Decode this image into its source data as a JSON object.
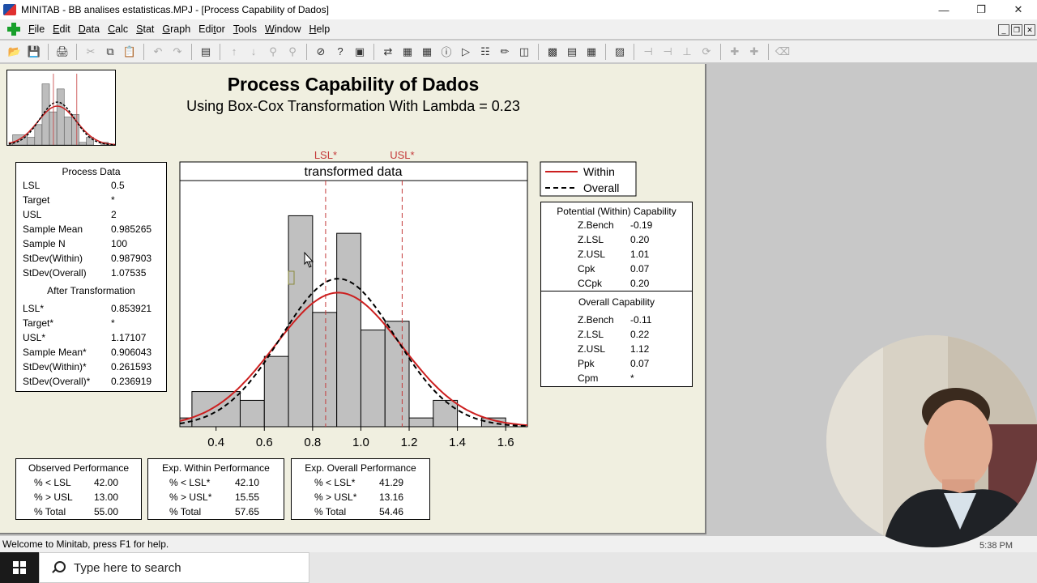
{
  "window": {
    "title": "MINITAB - BB analises estatisticas.MPJ - [Process Capability of Dados]"
  },
  "menu": [
    {
      "key": "F",
      "rest": "ile"
    },
    {
      "key": "E",
      "rest": "dit"
    },
    {
      "key": "D",
      "rest": "ata"
    },
    {
      "key": "C",
      "rest": "alc"
    },
    {
      "key": "S",
      "rest": "tat"
    },
    {
      "key": "G",
      "rest": "raph"
    },
    {
      "key": "",
      "rest": "Edi",
      "key2": "t",
      "rest2": "or"
    },
    {
      "key": "T",
      "rest": "ools"
    },
    {
      "key": "W",
      "rest": "indow"
    },
    {
      "key": "H",
      "rest": "elp"
    }
  ],
  "graph": {
    "title": "Process Capability of Dados",
    "subtitle": "Using Box-Cox Transformation With Lambda = 0.23",
    "panel_label": "transformed data",
    "lsl_label": "LSL*",
    "usl_label": "USL*",
    "legend": {
      "within": "Within",
      "overall": "Overall"
    },
    "colors": {
      "within": "#cc1f1f",
      "overall": "#000000",
      "bars": "#c0c0c0",
      "spec": "#c43a3a",
      "background": "#f0efe0"
    }
  },
  "process_data": {
    "header": "Process Data",
    "rows": [
      {
        "label": "LSL",
        "value": "0.5"
      },
      {
        "label": "Target",
        "value": "*"
      },
      {
        "label": "USL",
        "value": "2"
      },
      {
        "label": "Sample Mean",
        "value": "0.985265"
      },
      {
        "label": "Sample N",
        "value": "100"
      },
      {
        "label": "StDev(Within)",
        "value": "0.987903"
      },
      {
        "label": "StDev(Overall)",
        "value": "1.07535"
      }
    ],
    "after_header": "After Transformation",
    "after_rows": [
      {
        "label": "LSL*",
        "value": "0.853921"
      },
      {
        "label": "Target*",
        "value": "*"
      },
      {
        "label": "USL*",
        "value": "1.17107"
      },
      {
        "label": "Sample Mean*",
        "value": "0.906043"
      },
      {
        "label": "StDev(Within)*",
        "value": "0.261593"
      },
      {
        "label": "StDev(Overall)*",
        "value": "0.236919"
      }
    ]
  },
  "potential": {
    "header": "Potential (Within) Capability",
    "rows": [
      {
        "label": "Z.Bench",
        "value": "-0.19"
      },
      {
        "label": "Z.LSL",
        "value": "0.20"
      },
      {
        "label": "Z.USL",
        "value": "1.01"
      },
      {
        "label": "Cpk",
        "value": "0.07"
      },
      {
        "label": "CCpk",
        "value": "0.20"
      }
    ]
  },
  "overall": {
    "header": "Overall Capability",
    "rows": [
      {
        "label": "Z.Bench",
        "value": "-0.11"
      },
      {
        "label": "Z.LSL",
        "value": "0.22"
      },
      {
        "label": "Z.USL",
        "value": "1.12"
      },
      {
        "label": "Ppk",
        "value": "0.07"
      },
      {
        "label": "Cpm",
        "value": "*"
      }
    ]
  },
  "observed": {
    "header": "Observed Performance",
    "rows": [
      {
        "label": "% < LSL",
        "value": "42.00"
      },
      {
        "label": "% > USL",
        "value": "13.00"
      },
      {
        "label": "% Total",
        "value": "55.00"
      }
    ]
  },
  "exp_within": {
    "header": "Exp. Within Performance",
    "rows": [
      {
        "label": "% < LSL*",
        "value": "42.10"
      },
      {
        "label": "% > USL*",
        "value": "15.55"
      },
      {
        "label": "% Total",
        "value": "57.65"
      }
    ]
  },
  "exp_overall": {
    "header": "Exp. Overall Performance",
    "rows": [
      {
        "label": "% < LSL*",
        "value": "41.29"
      },
      {
        "label": "% > USL*",
        "value": "13.16"
      },
      {
        "label": "% Total",
        "value": "54.46"
      }
    ]
  },
  "chart_data": {
    "type": "bar",
    "title": "transformed data",
    "x_ticks": [
      "0.4",
      "0.6",
      "0.8",
      "1.0",
      "1.2",
      "1.4",
      "1.6"
    ],
    "xlim": [
      0.25,
      1.69
    ],
    "ylim": [
      0,
      28
    ],
    "bins": [
      {
        "x0": 0.25,
        "x1": 0.3,
        "count": 1
      },
      {
        "x0": 0.3,
        "x1": 0.5,
        "count": 4
      },
      {
        "x0": 0.5,
        "x1": 0.6,
        "count": 3
      },
      {
        "x0": 0.6,
        "x1": 0.7,
        "count": 8
      },
      {
        "x0": 0.7,
        "x1": 0.8,
        "count": 24
      },
      {
        "x0": 0.8,
        "x1": 0.9,
        "count": 13
      },
      {
        "x0": 0.9,
        "x1": 1.0,
        "count": 22
      },
      {
        "x0": 1.0,
        "x1": 1.1,
        "count": 11
      },
      {
        "x0": 1.1,
        "x1": 1.2,
        "count": 12
      },
      {
        "x0": 1.2,
        "x1": 1.3,
        "count": 1
      },
      {
        "x0": 1.3,
        "x1": 1.4,
        "count": 3
      },
      {
        "x0": 1.5,
        "x1": 1.6,
        "count": 1
      }
    ],
    "lsl": 0.853921,
    "usl": 1.17107,
    "mean": 0.906043,
    "sd_within": 0.261593,
    "sd_overall": 0.236919,
    "n": 100,
    "bin_width": 0.1,
    "series": [
      {
        "name": "Within",
        "style": "solid"
      },
      {
        "name": "Overall",
        "style": "dashed"
      }
    ]
  },
  "status": {
    "text": "Welcome to Minitab, press F1 for help.",
    "time": "5:38 PM"
  },
  "taskbar": {
    "search_placeholder": "Type here to search"
  }
}
